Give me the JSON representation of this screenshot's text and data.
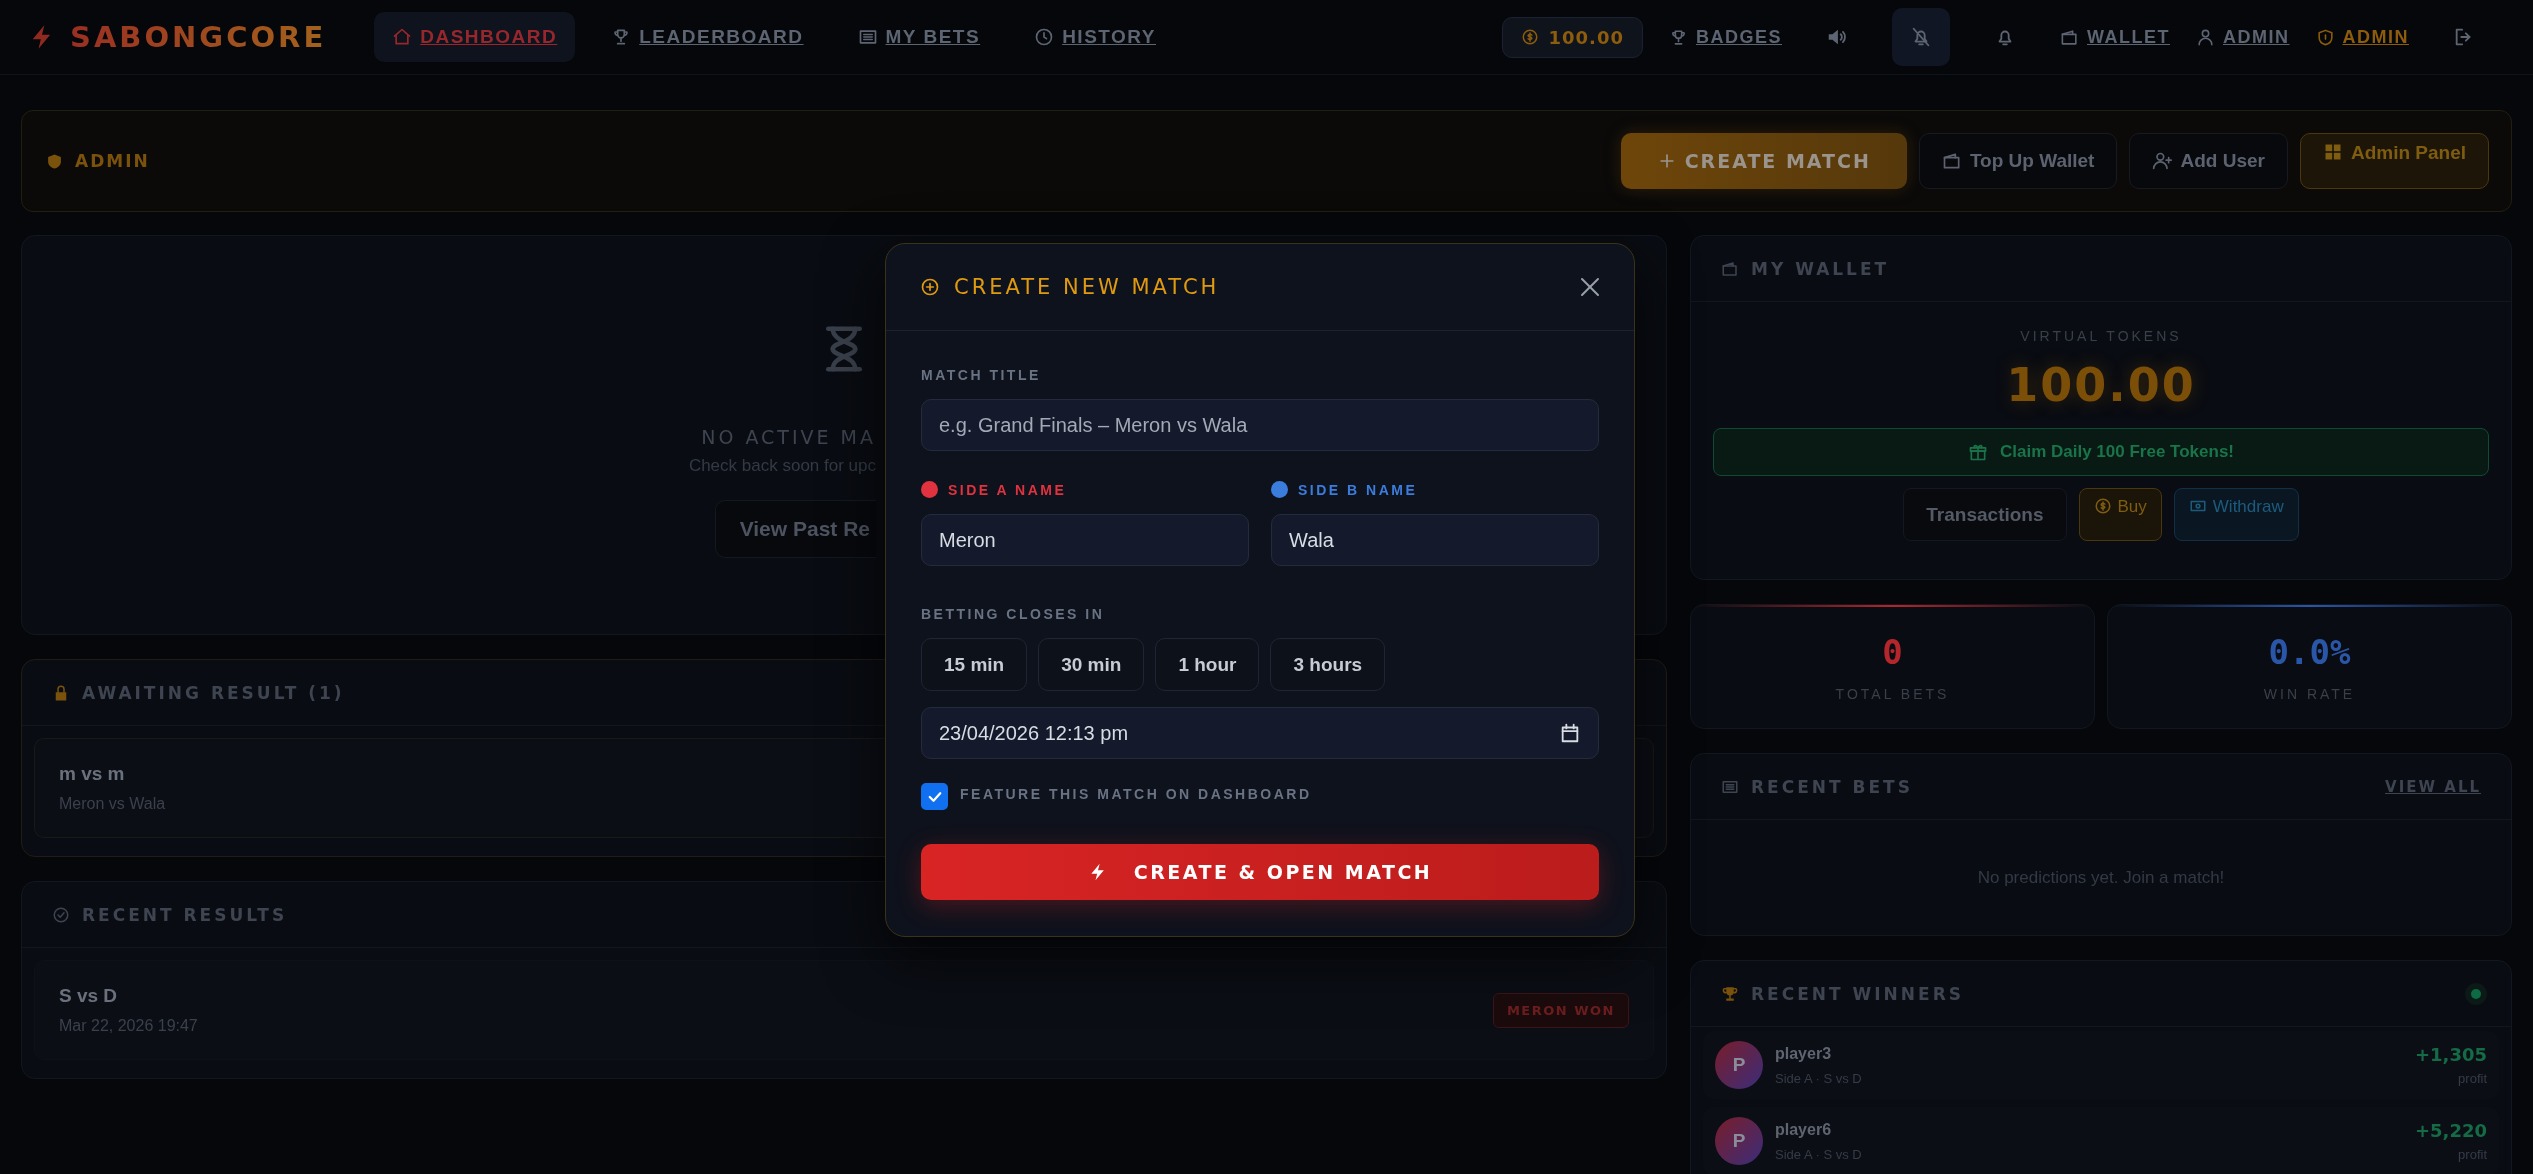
{
  "brand": {
    "name": "SABONGCORE"
  },
  "nav": [
    {
      "label": "DASHBOARD",
      "selected": true
    },
    {
      "label": "LEADERBOARD",
      "selected": false
    },
    {
      "label": "MY BETS",
      "selected": false
    },
    {
      "label": "HISTORY",
      "selected": false
    }
  ],
  "balance": "100.00",
  "header_actions": [
    {
      "kind": "link",
      "label": "BADGES",
      "accent": false
    },
    {
      "kind": "icon",
      "pressed": false
    },
    {
      "kind": "icon",
      "pressed": true
    },
    {
      "kind": "icon",
      "pressed": false
    },
    {
      "kind": "link",
      "label": "WALLET",
      "accent": false
    },
    {
      "kind": "link",
      "label": "ADMIN",
      "accent": false
    },
    {
      "kind": "link",
      "label": "ADMIN",
      "accent": true
    },
    {
      "kind": "icon",
      "pressed": false
    }
  ],
  "admin_bar": {
    "title": "ADMIN",
    "actions": [
      {
        "kind": "primary",
        "label": "CREATE MATCH"
      },
      {
        "kind": "ghost",
        "label": "Top Up Wallet"
      },
      {
        "kind": "ghost",
        "label": "Add User"
      },
      {
        "kind": "accent",
        "label": "Admin Panel"
      }
    ]
  },
  "empty_state": {
    "title": "NO ACTIVE MA",
    "text": "Check back soon for upc",
    "button": "View Past Re"
  },
  "awaiting": {
    "title": "AWAITING RESULT (1)",
    "items": [
      {
        "title": "m vs m",
        "subtitle": "Meron vs Wala"
      }
    ]
  },
  "recent_results": {
    "title": "RECENT RESULTS",
    "items": [
      {
        "title": "S vs D",
        "date": "Mar 22, 2026 19:47",
        "result": "MERON WON"
      }
    ]
  },
  "wallet": {
    "title": "MY WALLET",
    "label": "VIRTUAL TOKENS",
    "amount": "100.00",
    "claim": "Claim Daily 100 Free Tokens!",
    "buttons": [
      {
        "kind": "plain",
        "label": "Transactions"
      },
      {
        "kind": "buy",
        "label": "Buy"
      },
      {
        "kind": "withdraw",
        "label": "Withdraw"
      }
    ]
  },
  "stats": [
    {
      "value": "0",
      "label": "TOTAL BETS",
      "color": "#b3262b"
    },
    {
      "value": "0.0%",
      "label": "WIN RATE",
      "color": "#2a56a8"
    }
  ],
  "recent_bets": {
    "title": "RECENT BETS",
    "link": "VIEW ALL",
    "empty": "No predictions yet. Join a match!"
  },
  "recent_winners": {
    "title": "RECENT WINNERS",
    "live": true,
    "items": [
      {
        "avatar": "P",
        "name": "player3",
        "detail": "Side A · S vs D",
        "amount": "+1,305",
        "unit": "profit"
      },
      {
        "avatar": "P",
        "name": "player6",
        "detail": "Side A · S vs D",
        "amount": "+5,220",
        "unit": "profit"
      }
    ]
  },
  "modal": {
    "title": "CREATE NEW MATCH",
    "match_title": {
      "label": "MATCH TITLE",
      "placeholder": "e.g. Grand Finals – Meron vs Wala"
    },
    "sides": [
      {
        "label": "SIDE A NAME",
        "value": "Meron",
        "color": "#e0323f"
      },
      {
        "label": "SIDE B NAME",
        "value": "Wala",
        "color": "#3b7ddd"
      }
    ],
    "closes": {
      "label": "BETTING CLOSES IN",
      "presets": [
        {
          "label": "15 min",
          "selected": false
        },
        {
          "label": "30 min",
          "selected": false
        },
        {
          "label": "1 hour",
          "selected": false
        },
        {
          "label": "3 hours",
          "selected": false
        }
      ],
      "datetime": "23/04/2026 12:13 pm"
    },
    "feature": {
      "label": "FEATURE THIS MATCH ON DASHBOARD",
      "checked": true
    },
    "submit": "CREATE & OPEN MATCH"
  }
}
